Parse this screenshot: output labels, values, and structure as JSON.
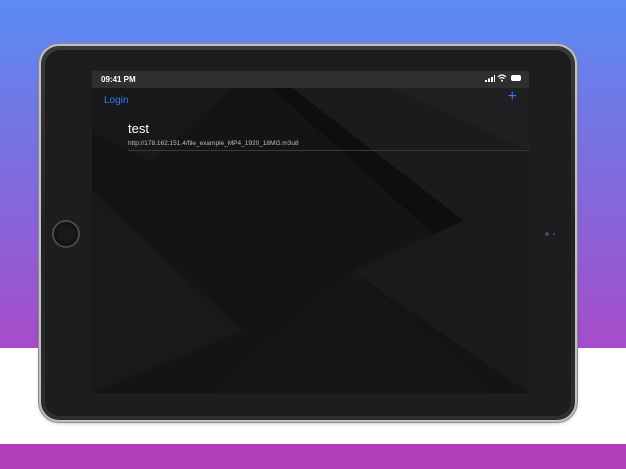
{
  "status_bar": {
    "time": "09:41 PM"
  },
  "nav": {
    "login_label": "Login",
    "add_label": "+"
  },
  "streams": [
    {
      "title": "test",
      "url": "http://178.162.151.4/file_example_MP4_1920_18MG.m3u8"
    }
  ],
  "colors": {
    "accent": "#2f7bf6",
    "background_top": "#5a8cf4",
    "background_bottom": "#b33fba",
    "screen_bg": "#0e0e10"
  },
  "icons": {
    "signal": "cellular-signal-icon",
    "wifi": "wifi-icon",
    "battery": "battery-icon",
    "add": "plus-icon"
  }
}
